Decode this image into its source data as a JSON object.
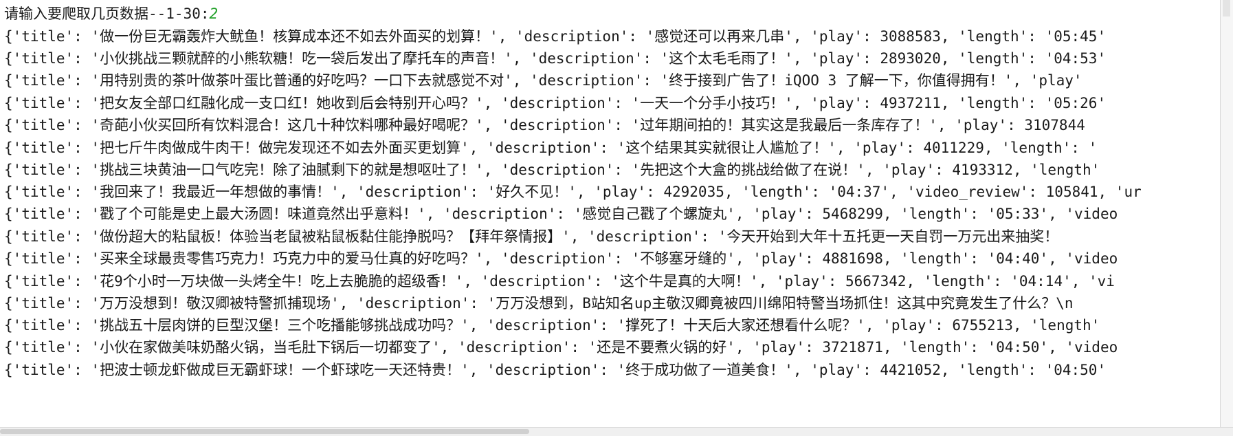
{
  "prompt": {
    "text": "请输入要爬取几页数据--1-30:",
    "value": "2"
  },
  "output_lines": [
    "{'title': '做一份巨无霸轰炸大鱿鱼！核算成本还不如去外面买的划算！', 'description': '感觉还可以再来几串', 'play': 3088583, 'length': '05:45'",
    "{'title': '小伙挑战三颗就醉的小熊软糖！吃一袋后发出了摩托车的声音！', 'description': '这个太毛毛雨了！', 'play': 2893020, 'length': '04:53'",
    "{'title': '用特别贵的茶叶做茶叶蛋比普通的好吃吗？一口下去就感觉不对', 'description': '终于接到广告了！iQOO 3 了解一下，你值得拥有！', 'play'",
    "{'title': '把女友全部口红融化成一支口红！她收到后会特别开心吗？', 'description': '一天一个分手小技巧！', 'play': 4937211, 'length': '05:26'",
    "{'title': '奇葩小伙买回所有饮料混合！这几十种饮料哪种最好喝呢？', 'description': '过年期间拍的！其实这是我最后一条库存了！', 'play': 3107844",
    "{'title': '把七斤牛肉做成牛肉干！做完发现还不如去外面买更划算', 'description': '这个结果其实就很让人尴尬了！', 'play': 4011229, 'length': '",
    "{'title': '挑战三块黄油一口气吃完！除了油腻剩下的就是想呕吐了！', 'description': '先把这个大盒的挑战给做了在说！', 'play': 4193312, 'length'",
    "{'title': '我回来了！我最近一年想做的事情！', 'description': '好久不见！', 'play': 4292035, 'length': '04:37', 'video_review': 105841, 'ur",
    "{'title': '戳了个可能是史上最大汤圆！味道竟然出乎意料！', 'description': '感觉自己戳了个螺旋丸', 'play': 5468299, 'length': '05:33', 'video",
    "{'title': '做份超大的粘鼠板！体验当老鼠被粘鼠板黏住能挣脱吗？【拜年祭情报】', 'description': '今天开始到大年十五托更一天自罚一万元出来抽奖！",
    "{'title': '买来全球最贵零售巧克力！巧克力中的爱马仕真的好吃吗？', 'description': '不够塞牙缝的', 'play': 4881698, 'length': '04:40', 'video",
    "{'title': '花9个小时一万块做一头烤全牛！吃上去脆脆的超级香！', 'description': '这个牛是真的大啊！', 'play': 5667342, 'length': '04:14', 'vi",
    "{'title': '万万没想到！敬汉卿被特警抓捕现场', 'description': '万万没想到，B站知名up主敬汉卿竟被四川绵阳特警当场抓住！这其中究竟发生了什么？\\n",
    "{'title': '挑战五十层肉饼的巨型汉堡！三个吃播能够挑战成功吗？', 'description': '撑死了！十天后大家还想看什么呢？', 'play': 6755213, 'length'",
    "{'title': '小伙在家做美味奶酪火锅，当毛肚下锅后一切都变了', 'description': '还是不要煮火锅的好', 'play': 3721871, 'length': '04:50', 'video",
    "{'title': '把波士顿龙虾做成巨无霸虾球！一个虾球吃一天还特贵！', 'description': '终于成功做了一道美食！', 'play': 4421052, 'length': '04:50'"
  ],
  "colors": {
    "input_value": "#22a02a",
    "text": "#1a1a1a"
  }
}
